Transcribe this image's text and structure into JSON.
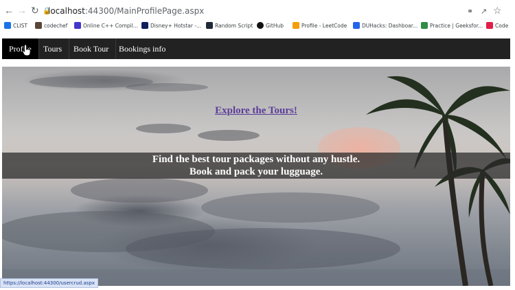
{
  "browser": {
    "url_host": "localhost",
    "url_rest": ":44300/MainProfilePage.aspx",
    "bookmarks": [
      {
        "label": "CLIST",
        "color": "#1a73e8"
      },
      {
        "label": "codechef",
        "color": "#5b4636"
      },
      {
        "label": "Online C++ Compil...",
        "color": "#4338ca"
      },
      {
        "label": "Disney+ Hotstar -...",
        "color": "#0f1f5c"
      },
      {
        "label": "Random Script",
        "color": "#1f2937"
      },
      {
        "label": "GitHub",
        "color": "#111111"
      },
      {
        "label": "Profile - LeetCode",
        "color": "#f59e0b"
      },
      {
        "label": "DUHacks: Dashboar...",
        "color": "#2563eb"
      },
      {
        "label": "Practice | Geeksfor...",
        "color": "#2f8d46"
      },
      {
        "label": "Code",
        "color": "#e11d48"
      }
    ]
  },
  "nav": {
    "items": [
      {
        "label": "Profile"
      },
      {
        "label": "Tours"
      },
      {
        "label": "Book Tour"
      },
      {
        "label": "Bookings info"
      }
    ]
  },
  "hero": {
    "link_text": "Explore the Tours!",
    "tagline_line1": "Find the best tour packages without any hustle.",
    "tagline_line2": "Book and pack your lugguage."
  },
  "status": {
    "hover_url": "https://localhost:44300/usercrud.aspx"
  }
}
